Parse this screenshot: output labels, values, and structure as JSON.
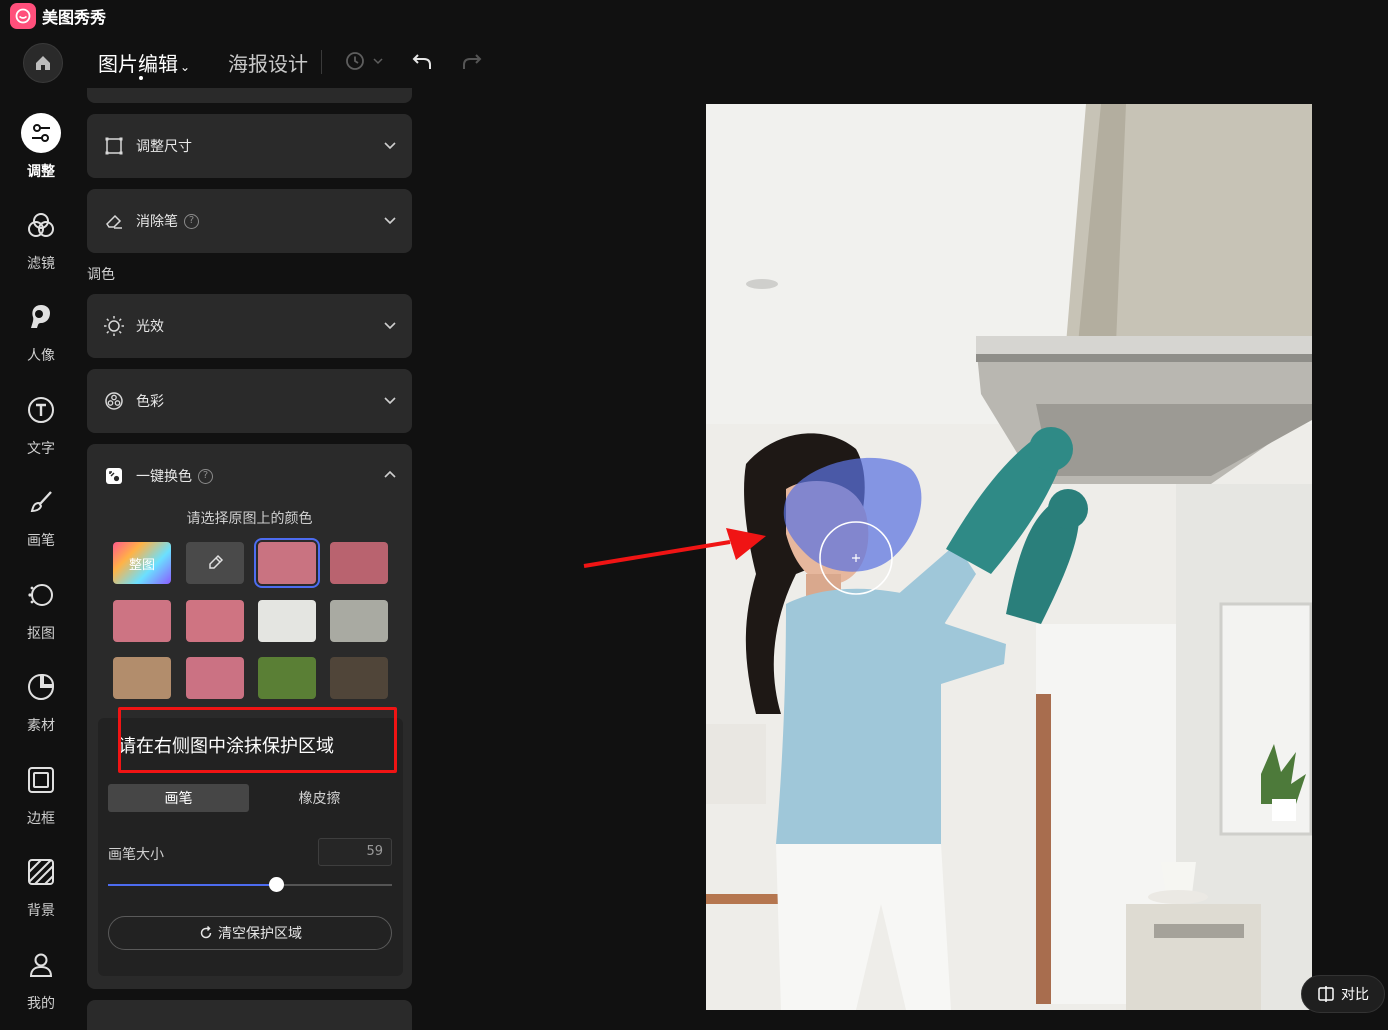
{
  "app": {
    "name": "美图秀秀"
  },
  "toolbar": {
    "tab_edit": "图片编辑",
    "tab_poster": "海报设计"
  },
  "rail": [
    {
      "label": "调整",
      "icon": "adjust-icon"
    },
    {
      "label": "滤镜",
      "icon": "filter-icon"
    },
    {
      "label": "人像",
      "icon": "portrait-icon"
    },
    {
      "label": "文字",
      "icon": "text-icon"
    },
    {
      "label": "画笔",
      "icon": "brush-icon"
    },
    {
      "label": "抠图",
      "icon": "cutout-icon"
    },
    {
      "label": "素材",
      "icon": "sticker-icon"
    },
    {
      "label": "边框",
      "icon": "frame-icon"
    },
    {
      "label": "背景",
      "icon": "background-icon"
    },
    {
      "label": "我的",
      "icon": "user-icon"
    }
  ],
  "panel": {
    "resize_title": "调整尺寸",
    "eraser_title": "消除笔",
    "color_section": "调色",
    "light_title": "光效",
    "color_title": "色彩",
    "swap": {
      "title": "一键换色",
      "prompt": "请选择原图上的颜色",
      "all_label": "整图",
      "swatches": [
        "#c97381",
        "#b9636f",
        "#cd7483",
        "#cf7482",
        "#e4e5e1",
        "#a9aaa2",
        "#b28d6c",
        "#cb7283",
        "#5a7f35",
        "#504539"
      ]
    },
    "protect": {
      "hint": "请在右侧图中涂抹保护区域",
      "brush_tab": "画笔",
      "eraser_tab": "橡皮擦",
      "size_label": "画笔大小",
      "size_value": "59",
      "size_fraction": 0.59,
      "clear_label": "清空保护区域"
    }
  },
  "canvas": {
    "compare_label": "对比"
  },
  "colors": {
    "accent": "#4d6cf0",
    "annotation": "#f01414"
  }
}
